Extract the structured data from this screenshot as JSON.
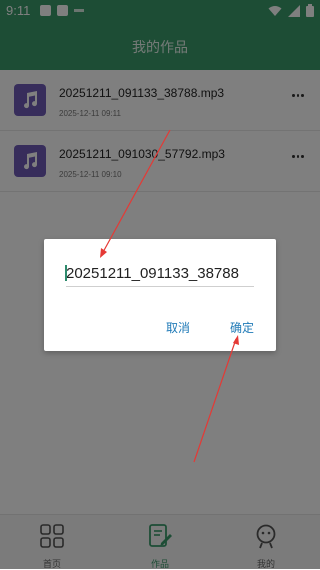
{
  "status_bar": {
    "time": "9:11"
  },
  "header": {
    "title": "我的作品"
  },
  "items": [
    {
      "name": "20251211_091133_38788.mp3",
      "date": "2025-12-11 09:11"
    },
    {
      "name": "20251211_091030_57792.mp3",
      "date": "2025-12-11 09:10"
    }
  ],
  "dialog": {
    "input_value": "20251211_091133_38788",
    "cancel": "取消",
    "ok": "确定"
  },
  "tabs": [
    {
      "label": "首页",
      "icon": "grid-icon"
    },
    {
      "label": "作品",
      "icon": "edit-note-icon",
      "active": true
    },
    {
      "label": "我的",
      "icon": "person-icon"
    }
  ],
  "colors": {
    "accent": "#3a9a6b",
    "thumb": "#6f5bb7",
    "button_blue": "#1f7ab7",
    "annotation_red": "#e53935"
  }
}
